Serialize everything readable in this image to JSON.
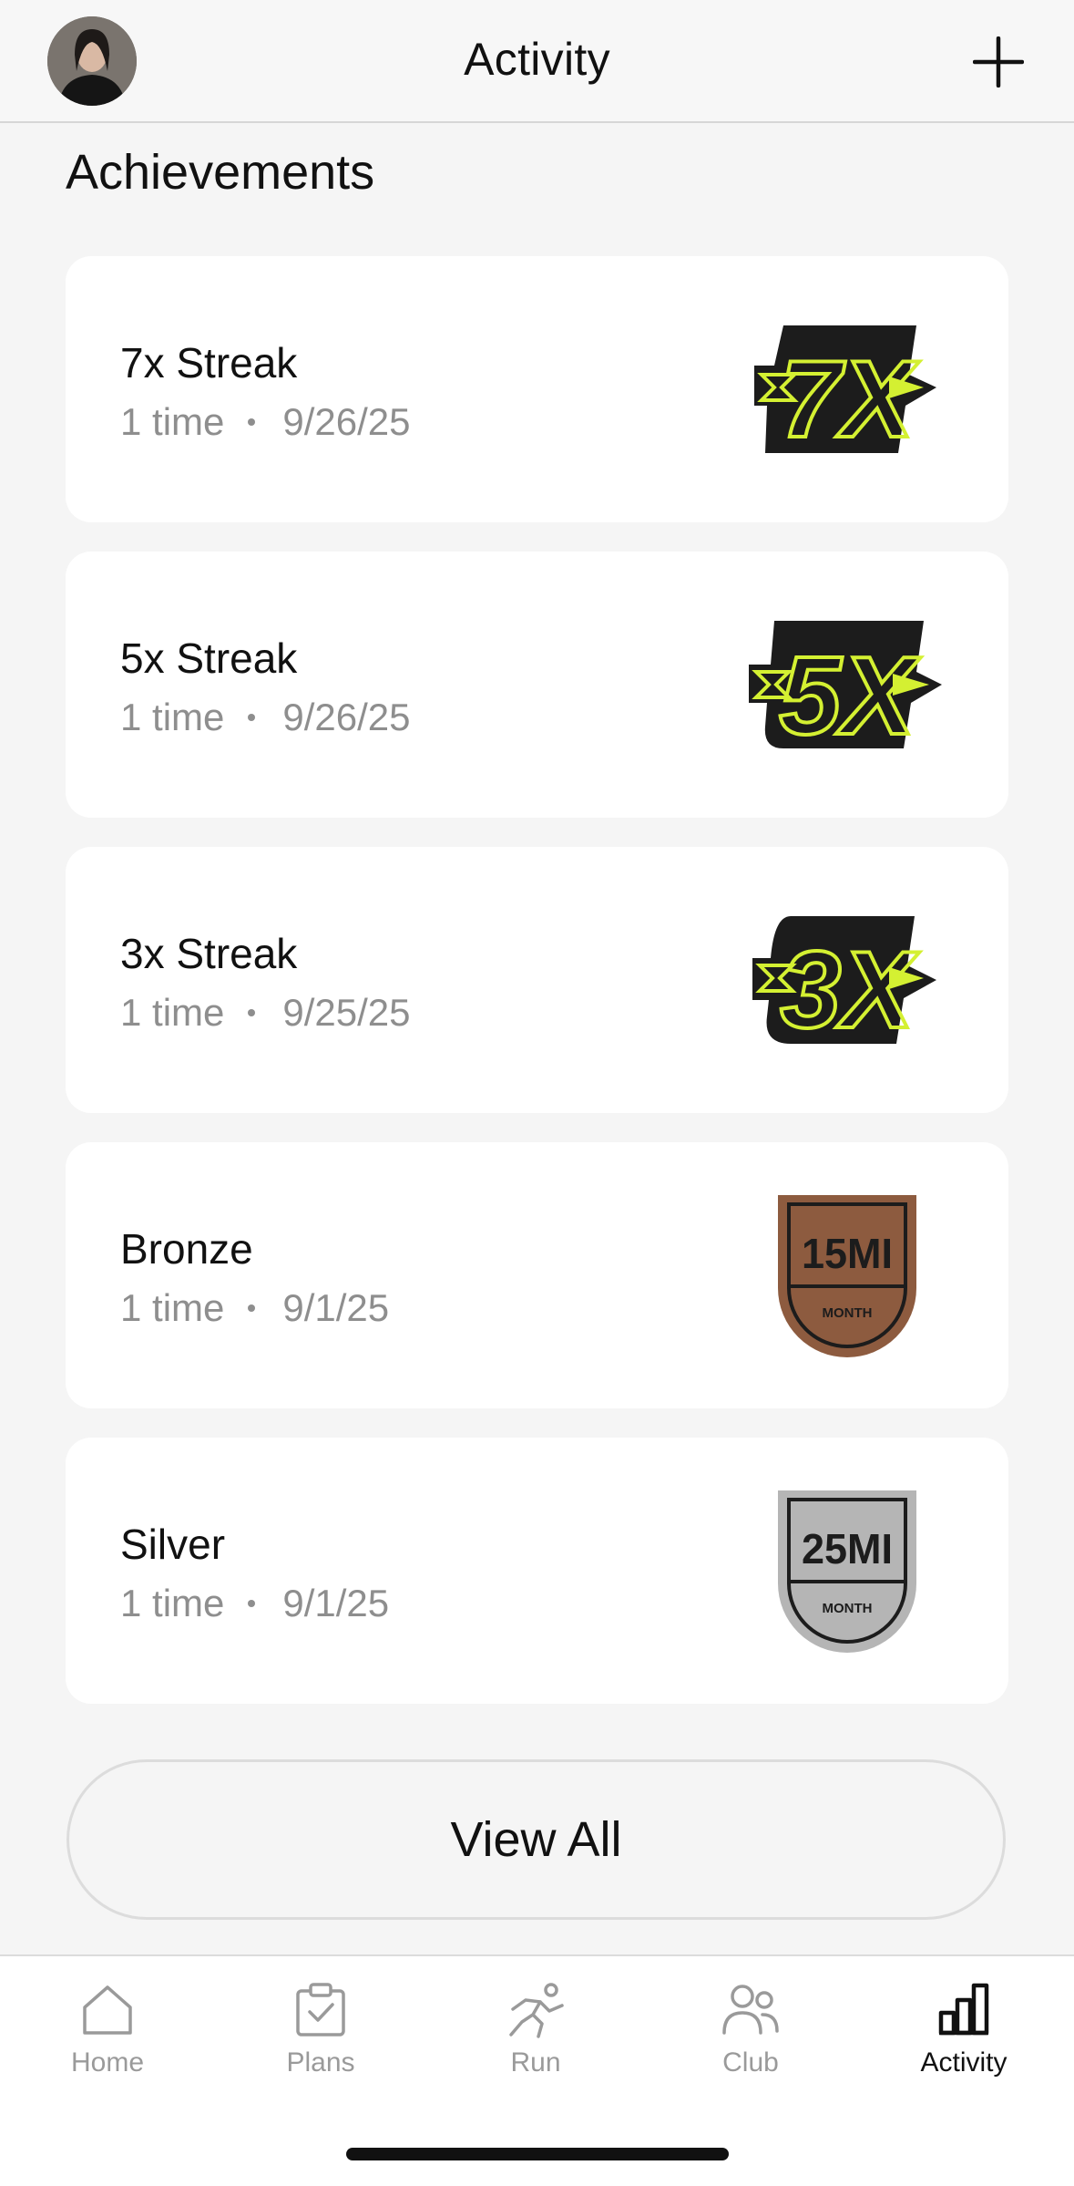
{
  "header": {
    "title": "Activity",
    "add_icon": "plus-icon"
  },
  "section": {
    "title": "Achievements"
  },
  "achievements": [
    {
      "title": "7x Streak",
      "count": "1 time",
      "date": "9/26/25",
      "badge": "streak-7x-badge",
      "badge_text": "7X"
    },
    {
      "title": "5x Streak",
      "count": "1 time",
      "date": "9/26/25",
      "badge": "streak-5x-badge",
      "badge_text": "5X"
    },
    {
      "title": "3x Streak",
      "count": "1 time",
      "date": "9/25/25",
      "badge": "streak-3x-badge",
      "badge_text": "3X"
    },
    {
      "title": "Bronze",
      "count": "1 time",
      "date": "9/1/25",
      "badge": "bronze-15mi-badge",
      "badge_text": "15MI",
      "badge_sub": "MONTH"
    },
    {
      "title": "Silver",
      "count": "1 time",
      "date": "9/1/25",
      "badge": "silver-25mi-badge",
      "badge_text": "25MI",
      "badge_sub": "MONTH"
    }
  ],
  "view_all_label": "View All",
  "tabbar": {
    "items": [
      {
        "label": "Home",
        "icon": "home-icon"
      },
      {
        "label": "Plans",
        "icon": "clipboard-check-icon"
      },
      {
        "label": "Run",
        "icon": "runner-icon"
      },
      {
        "label": "Club",
        "icon": "people-icon"
      },
      {
        "label": "Activity",
        "icon": "bar-chart-icon",
        "active": true
      }
    ]
  },
  "colors": {
    "streak_green": "#d4f032",
    "streak_dark": "#1c1c1c",
    "bronze": "#8d5b3f",
    "silver": "#b5b5b5"
  }
}
